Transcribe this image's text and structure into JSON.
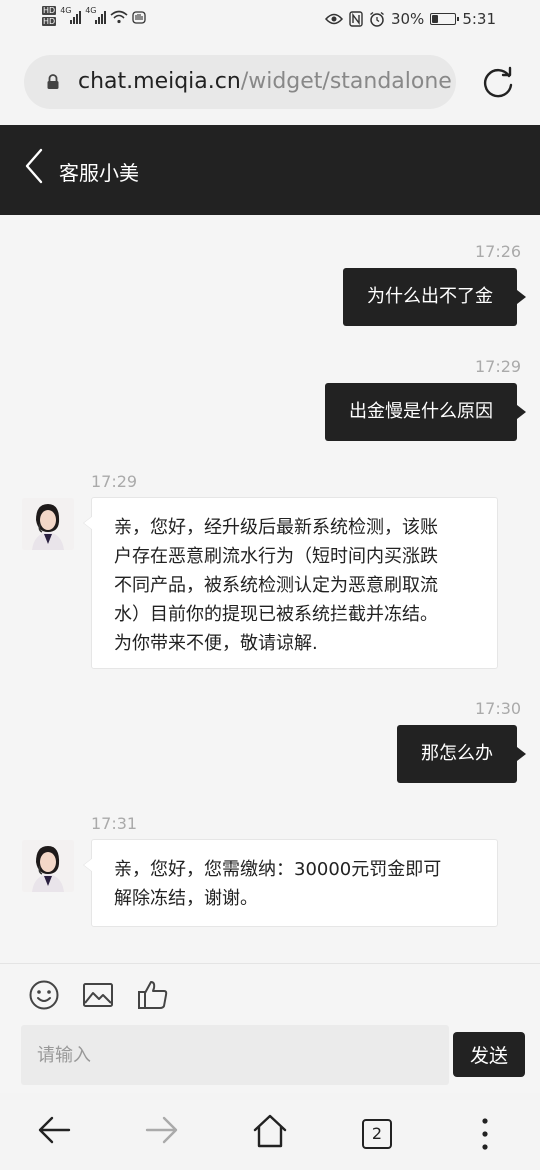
{
  "status_bar": {
    "hd_labels": [
      "HD",
      "HD"
    ],
    "network_labels": [
      "4G",
      "4G"
    ],
    "battery_percent": "30%",
    "battery_level": 0.3,
    "time": "5:31"
  },
  "browser": {
    "url_host": "chat.meiqia.cn",
    "url_path": "/widget/standalone"
  },
  "header": {
    "title": "客服小美"
  },
  "messages": [
    {
      "time": "17:26",
      "direction": "out",
      "text": "为什么出不了金"
    },
    {
      "time": "17:29",
      "direction": "out",
      "text": "出金慢是什么原因"
    },
    {
      "time": "17:29",
      "direction": "in",
      "lines": [
        "亲，您好，经升级后最新系统检测，该账",
        "户存在恶意刷流水行为（短时间内买涨跌",
        "不同产品，被系统检测认定为恶意刷取流",
        "水）目前你的提现已被系统拦截并冻结。",
        "为你带来不便，敬请谅解."
      ]
    },
    {
      "time": "17:30",
      "direction": "out",
      "text": "那怎么办"
    },
    {
      "time": "17:31",
      "direction": "in",
      "lines": [
        "亲，您好，您需缴纳：30000元罚金即可",
        "解除冻结，谢谢。"
      ]
    }
  ],
  "composer": {
    "placeholder": "请输入",
    "send_label": "发送",
    "tools": [
      "emoji-icon",
      "image-icon",
      "thumbs-up-icon"
    ]
  },
  "nav": {
    "tab_count": "2"
  }
}
